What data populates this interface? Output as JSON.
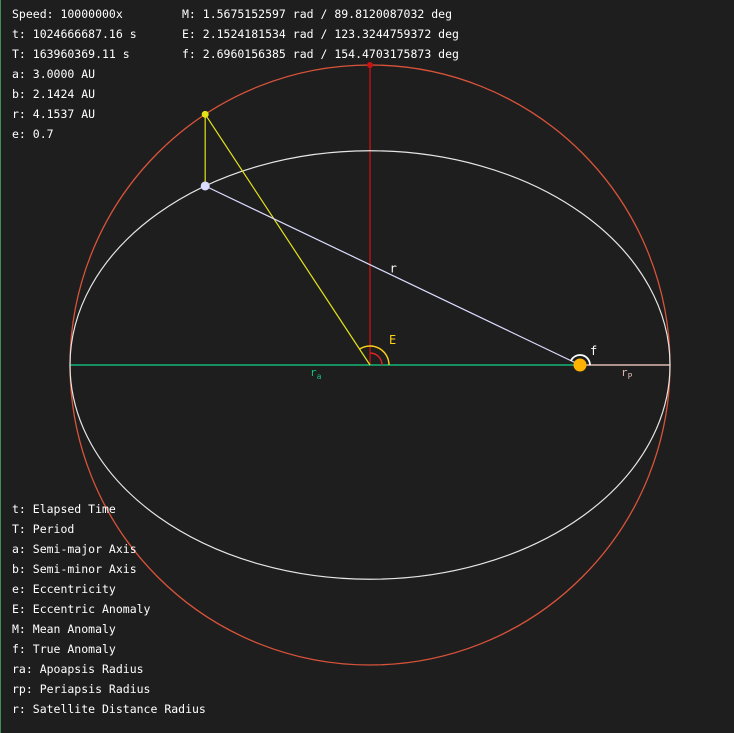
{
  "readouts": {
    "speed": "Speed: 10000000x",
    "t": "t: 1024666687.16 s",
    "T": "T: 163960369.11 s",
    "a": "a: 3.0000 AU",
    "b": "b: 2.1424 AU",
    "r": "r: 4.1537 AU",
    "e": "e: 0.7",
    "M": "M: 1.5675152597 rad / 89.8120087032 deg",
    "E": "E: 2.1524181534 rad / 123.3244759372 deg",
    "f": "f: 2.6960156385 rad / 154.4703175873 deg"
  },
  "legend": [
    "t: Elapsed Time",
    "T: Period",
    "a: Semi-major Axis",
    "b: Semi-minor Axis",
    "e: Eccentricity",
    "E: Eccentric Anomaly",
    "M: Mean Anomaly",
    "f: True Anomaly",
    "ra: Apoapsis Radius",
    "rp: Periapsis Radius",
    "r: Satellite Distance Radius"
  ],
  "diagram": {
    "labels": {
      "r": "r",
      "E": "E",
      "f": "f",
      "ra_main": "r",
      "ra_sub": "a",
      "rp_main": "r",
      "rp_sub": "P"
    },
    "eccentricity": 0.7,
    "eccentric_anomaly_deg": 123.3244759372,
    "true_anomaly_deg": 154.4703175873,
    "colors": {
      "auxiliary_circle": "#d9533a",
      "orbit": "#e6e6e6",
      "apoapsis_line": "#16a06b",
      "periapsis_line": "#e0b8b0",
      "semi_minor_line": "#cc1111",
      "projection_line": "#e3e31a",
      "radius_line": "#dcdcff",
      "focus": "#ffb300",
      "eccentric_arc": "#ffd21a",
      "mean_arc": "#dd2222",
      "true_arc": "#ffffff"
    }
  }
}
